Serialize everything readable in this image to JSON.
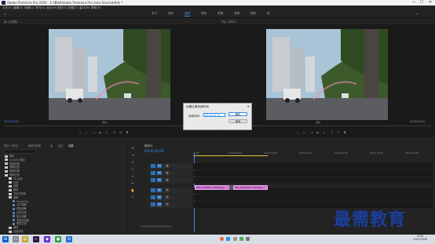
{
  "window": {
    "title": "Adobe Premiere Pro 2020 - E:\\素材\\Adobe Premiere Pro Auto-Save\\未命名 *",
    "controls": [
      "—",
      "☐",
      "✕"
    ]
  },
  "menu": [
    "文件(F)",
    "编辑(E)",
    "剪辑(C)",
    "序列(S)",
    "标记(M)",
    "图形(G)",
    "视图(V)",
    "窗口(W)",
    "帮助(H)"
  ],
  "workspaces": [
    "学习",
    "组件",
    "编辑",
    "颜色",
    "效果",
    "音频",
    "图形",
    "库"
  ],
  "active_workspace": "编辑",
  "source_monitor": {
    "tab": "源: (无剪辑)",
    "timecode_left": "00;00;00;00",
    "fit": "适合"
  },
  "program_monitor": {
    "tab": "节目: 序列01",
    "timecode_left": "00;00;00;00",
    "fit": "适合",
    "timecode_right": "00;00;20;00"
  },
  "dialog": {
    "title": "设置过渡持续时间",
    "label": "持续时间:",
    "value": "00;00;00;15",
    "ok": "确定",
    "cancel": "取消"
  },
  "project_panel": {
    "tabs": [
      "项目: 未命名",
      "媒体浏览器",
      "库",
      "信息",
      "效果"
    ],
    "items": [
      {
        "label": "预设",
        "indent": 0
      },
      {
        "label": "Lumetri 预设",
        "indent": 0
      },
      {
        "label": "音频效果",
        "indent": 0
      },
      {
        "label": "音频过渡",
        "indent": 0
      },
      {
        "label": "视频效果",
        "indent": 0
      },
      {
        "label": "视频过渡",
        "indent": 0
      },
      {
        "label": "3D 运动",
        "indent": 1
      },
      {
        "label": "内滑",
        "indent": 1
      },
      {
        "label": "划像",
        "indent": 1
      },
      {
        "label": "擦除",
        "indent": 1
      },
      {
        "label": "沉浸式视频",
        "indent": 1
      },
      {
        "label": "溶解",
        "indent": 1
      },
      {
        "label": "MorphCut",
        "indent": 2
      },
      {
        "label": "交叉溶解",
        "indent": 2
      },
      {
        "label": "叠加溶解",
        "indent": 2
      },
      {
        "label": "白场过渡",
        "indent": 2
      },
      {
        "label": "胶片溶解",
        "indent": 2
      },
      {
        "label": "非叠加溶解",
        "indent": 2
      },
      {
        "label": "黑场过渡",
        "indent": 2
      },
      {
        "label": "缩放",
        "indent": 1
      },
      {
        "label": "页面剥落",
        "indent": 1
      }
    ]
  },
  "timeline": {
    "tab": "序列01",
    "timecode": "00;00;00;00",
    "ruler": [
      "00;00",
      "00;00;05;00",
      "00;00;10;00",
      "00;00;15;00",
      "00;00;20;00",
      "00;00;25;00",
      "00;00;30;00"
    ],
    "tracks": [
      "V3",
      "V2",
      "V1",
      "A1",
      "A2",
      "A3"
    ],
    "clips": [
      "IMG_20210907_125553.jpg",
      "IMG_20210908_171838.jpg"
    ]
  },
  "taskbar": {
    "time": "9:34",
    "date": "2021/10/8"
  },
  "watermark": "最需教育",
  "colors": {
    "accent": "#2d8ceb",
    "clip": "#d27ad6",
    "background": "#1d1d1d"
  }
}
